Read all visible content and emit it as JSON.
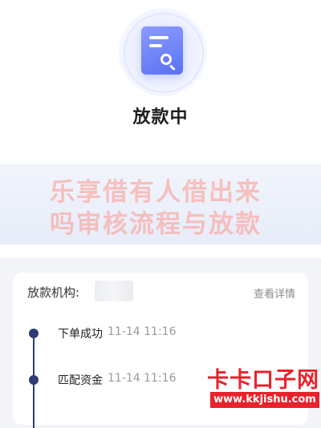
{
  "status": {
    "title": "放款中",
    "icon": "document-search-icon"
  },
  "watermark": {
    "line1": "乐享借有人借出来",
    "line2": "吗审核流程与放款"
  },
  "loan_info": {
    "org_label": "放款机构:",
    "detail_link": "查看详情"
  },
  "timeline": [
    {
      "label": "下单成功",
      "time": "11-14 11:16"
    },
    {
      "label": "匹配资金",
      "time": "11-14 11:16"
    }
  ],
  "site_watermark": {
    "name": "卡卡口子网",
    "url": "www.kkjishu.com"
  },
  "colors": {
    "accent": "#5a72f2",
    "timeline": "#2f3c73",
    "logo_red": "#e8222b"
  }
}
